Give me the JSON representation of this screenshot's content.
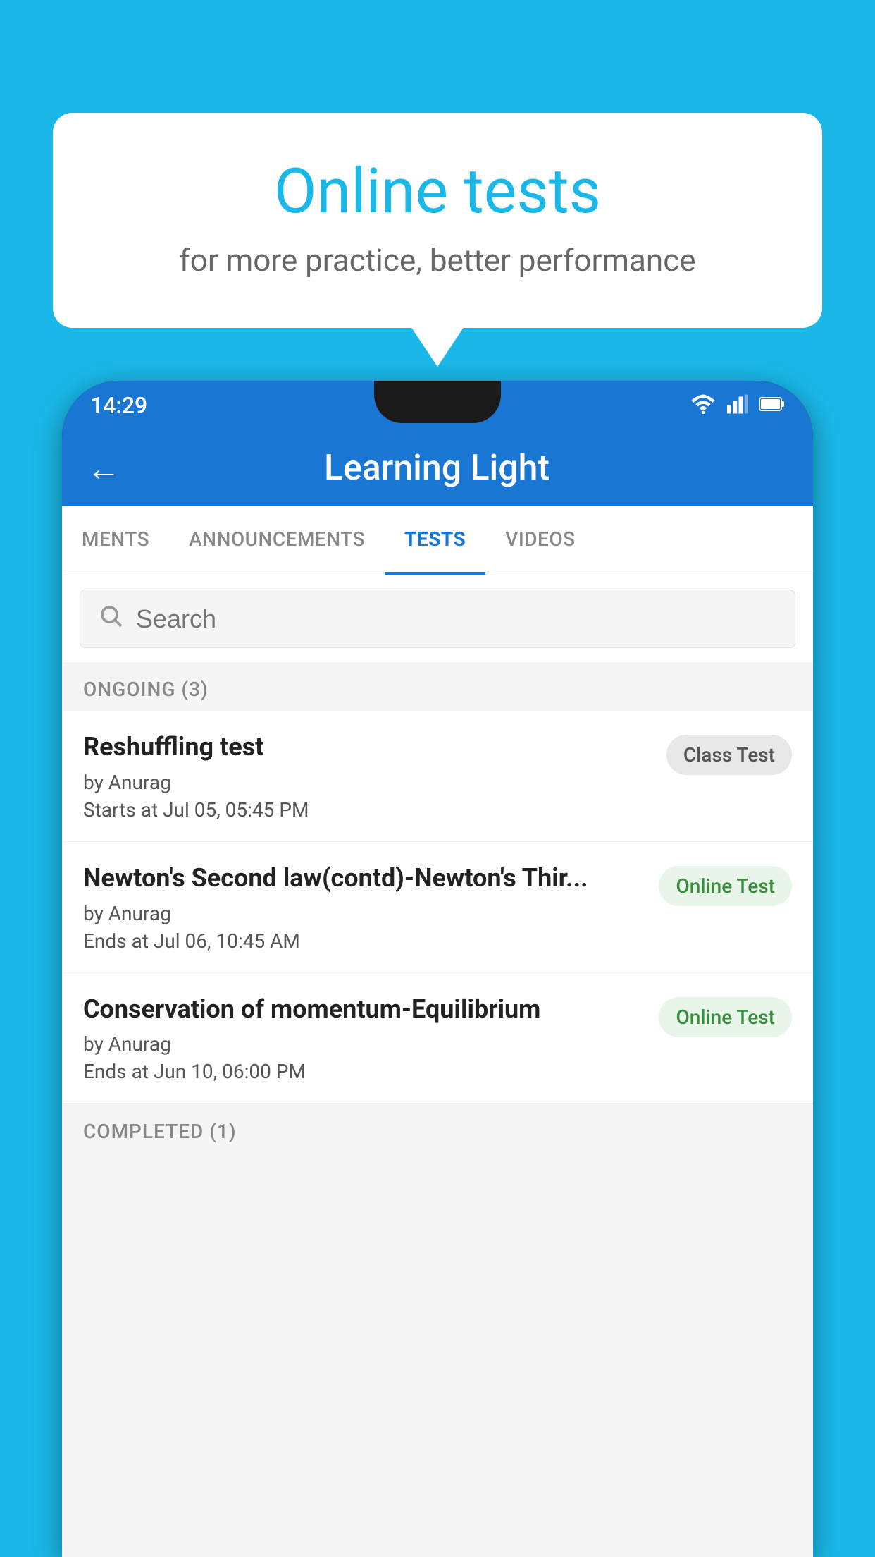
{
  "background": {
    "color": "#1ab8e8"
  },
  "bubble": {
    "title": "Online tests",
    "subtitle": "for more practice, better performance"
  },
  "phone": {
    "statusBar": {
      "time": "14:29",
      "icons": [
        "wifi",
        "signal",
        "battery"
      ]
    },
    "header": {
      "backLabel": "←",
      "title": "Learning Light"
    },
    "tabs": [
      {
        "label": "MENTS",
        "active": false
      },
      {
        "label": "ANNOUNCEMENTS",
        "active": false
      },
      {
        "label": "TESTS",
        "active": true
      },
      {
        "label": "VIDEOS",
        "active": false
      }
    ],
    "search": {
      "placeholder": "Search"
    },
    "ongoingSection": {
      "label": "ONGOING (3)"
    },
    "tests": [
      {
        "name": "Reshuffling test",
        "author": "by Anurag",
        "time": "Starts at  Jul 05, 05:45 PM",
        "badge": "Class Test",
        "badgeType": "class"
      },
      {
        "name": "Newton's Second law(contd)-Newton's Thir...",
        "author": "by Anurag",
        "time": "Ends at  Jul 06, 10:45 AM",
        "badge": "Online Test",
        "badgeType": "online"
      },
      {
        "name": "Conservation of momentum-Equilibrium",
        "author": "by Anurag",
        "time": "Ends at  Jun 10, 06:00 PM",
        "badge": "Online Test",
        "badgeType": "online"
      }
    ],
    "completedSection": {
      "label": "COMPLETED (1)"
    }
  }
}
